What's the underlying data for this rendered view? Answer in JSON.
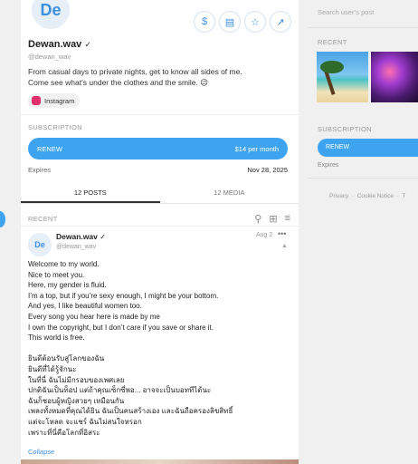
{
  "profile": {
    "avatar_initials": "De",
    "name": "Dewan.wav",
    "handle": "@dewan_wav",
    "bio_line1": "From casual days to private nights, get to know all sides of me.",
    "bio_line2": "Come see what’s under the clothes and the smile. 😉",
    "social_label": "Instagram"
  },
  "subscription": {
    "title": "SUBSCRIPTION",
    "button_label": "RENEW",
    "price": "$14 per month",
    "expires_label": "Expires",
    "expires_date": "Nov 28, 2025"
  },
  "tabs": [
    {
      "label": "12 POSTS",
      "active": true
    },
    {
      "label": "12 MEDIA",
      "active": false
    }
  ],
  "feed": {
    "title": "RECENT",
    "post": {
      "avatar_initials": "De",
      "name": "Dewan.wav",
      "handle": "@dewan_wav",
      "date": "Aug 2",
      "lines": [
        "Welcome to my world.",
        "Nice to meet you.",
        "Here, my gender is fluid.",
        "I’m a top, but if you’re sexy enough, I might be your bottom.",
        "And yes, I like beautiful women too.",
        "Every song you hear here is made by me",
        "I own the copyright, but I don’t care if you save or share it.",
        "This world is free.",
        "",
        "ยินดีต้อนรับสู่โลกของฉัน",
        "ยินดีที่ได้รู้จักนะ",
        "ในที่นี่ ฉันไม่มีกรอบของเพศเลย",
        "ปกติฉันเป็นท็อป แต่ถ้าคุณเซ็กซี่พอ... อาจจะเป็นบอททีได้นะ",
        "ฉันก็ชอบผู้หญิงสวยๆ เหมือนกัน",
        "เพลงทั้งหมดที่คุณได้ยิน ฉันเป็นคนสร้างเอง และฉันถือครองลิขสิทธิ์",
        "แต่จะโหลด จะแชร์ ฉันไม่สนใจหรอก",
        "เพราะที่นี่คือโลกที่อิสระ"
      ],
      "collapse_label": "Collapse"
    }
  },
  "sidebar": {
    "search_placeholder": "Search user’s post",
    "recent_title": "RECENT",
    "subscription_title": "SUBSCRIPTION",
    "renew_label": "RENEW",
    "expires_label": "Expires",
    "footer_privacy": "Privacy",
    "footer_cookie": "Cookie Notice",
    "footer_more": "T"
  },
  "colors": {
    "accent": "#3fa4f0",
    "instagram": "#e1306c"
  }
}
